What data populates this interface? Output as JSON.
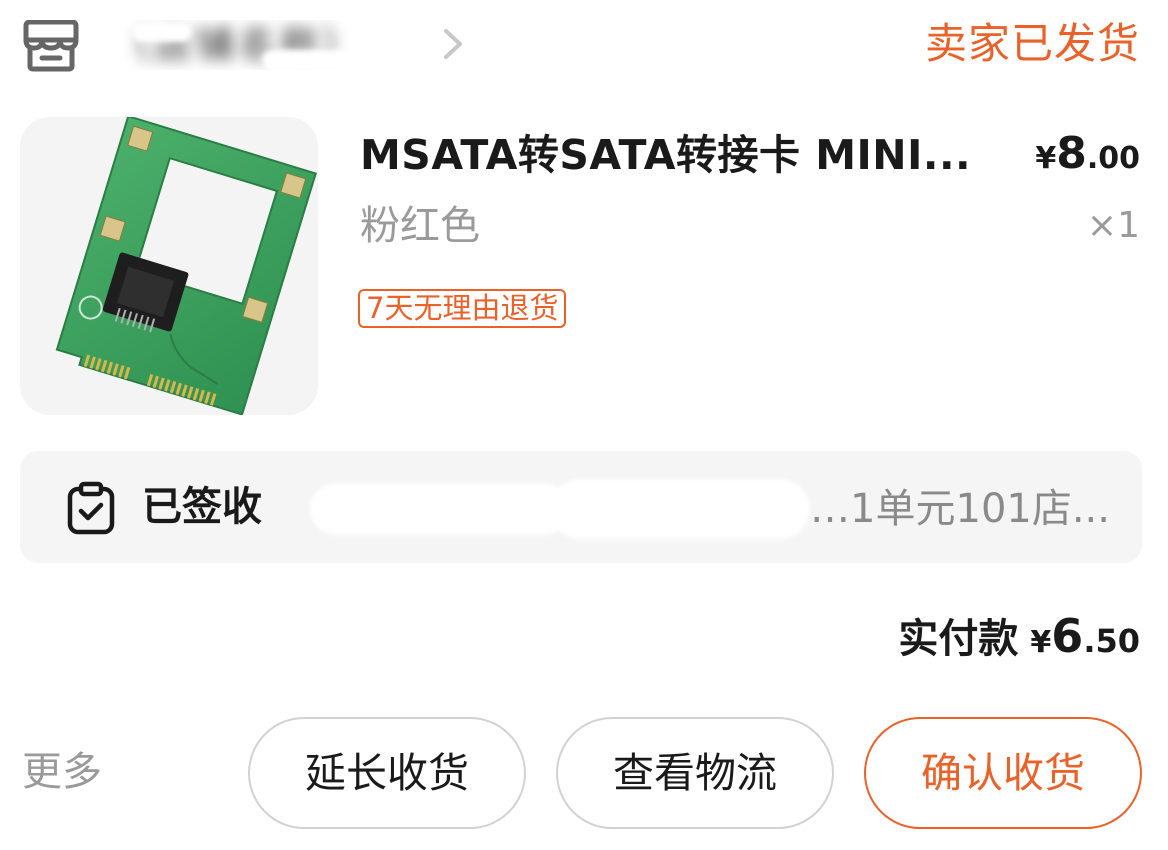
{
  "header": {
    "shop_icon": "shop-icon",
    "shop_name": "（店铺名称）",
    "chevron": "chevron-right-icon",
    "order_status": "卖家已发货"
  },
  "product": {
    "image": "msata-to-sata-adapter-card",
    "title": "MSATA转SATA转接卡 MINI...",
    "price": {
      "currency": "¥",
      "integer": "8",
      "decimal": ".00"
    },
    "variant": "粉红色",
    "quantity": "×1",
    "tag": "7天无理由退货"
  },
  "logistics": {
    "icon": "clipboard-check-icon",
    "status": "已签收",
    "address": "…1单元101店..."
  },
  "payment": {
    "label": "实付款",
    "currency": "¥",
    "integer": "6",
    "decimal": ".50"
  },
  "actions": {
    "more": "更多",
    "extend_label": "延长收货",
    "track_label": "查看物流",
    "confirm_label": "确认收货"
  },
  "colors": {
    "accent": "#e8622a",
    "muted": "#9a9a9a",
    "text": "#1a1a1a",
    "panel": "#f5f5f5"
  }
}
